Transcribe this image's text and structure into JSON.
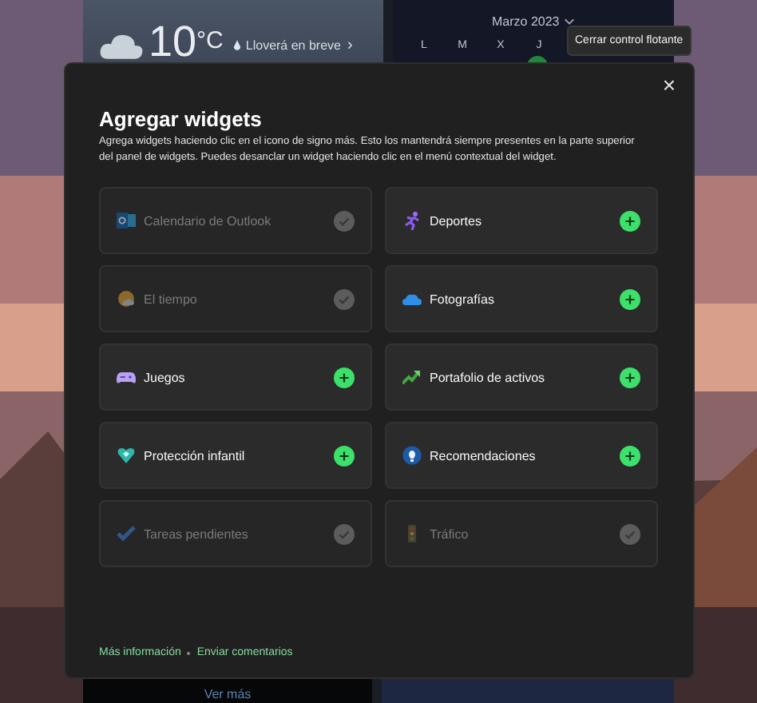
{
  "background": {
    "weather": {
      "temperature": "10",
      "unit": "°C",
      "forecast": "Lloverá en breve",
      "forecast_chevron": "›"
    },
    "calendar": {
      "month": "Marzo 2023",
      "weekdays": [
        "L",
        "M",
        "X",
        "J"
      ]
    },
    "see_more": "Ver más"
  },
  "tooltip": "Cerrar control flotante",
  "dialog": {
    "close": "×",
    "title": "Agregar widgets",
    "description": "Agrega widgets haciendo clic en el icono de signo más. Esto los mantendrá siempre presentes en la parte superior del panel de widgets. Puedes desanclar un widget haciendo clic en el menú contextual del widget.",
    "widgets": [
      {
        "label": "Calendario de Outlook",
        "added": true,
        "kind": "outlook"
      },
      {
        "label": "Deportes",
        "added": false,
        "kind": "sports"
      },
      {
        "label": "El tiempo",
        "added": true,
        "kind": "weather"
      },
      {
        "label": "Fotografías",
        "added": false,
        "kind": "photos"
      },
      {
        "label": "Juegos",
        "added": false,
        "kind": "games"
      },
      {
        "label": "Portafolio de activos",
        "added": false,
        "kind": "stocks"
      },
      {
        "label": "Protección infantil",
        "added": false,
        "kind": "kids"
      },
      {
        "label": "Recomendaciones",
        "added": false,
        "kind": "tips"
      },
      {
        "label": "Tareas pendientes",
        "added": true,
        "kind": "todo"
      },
      {
        "label": "Tráfico",
        "added": true,
        "kind": "traffic"
      }
    ],
    "links": [
      "Más información",
      "Enviar comentarios"
    ]
  }
}
